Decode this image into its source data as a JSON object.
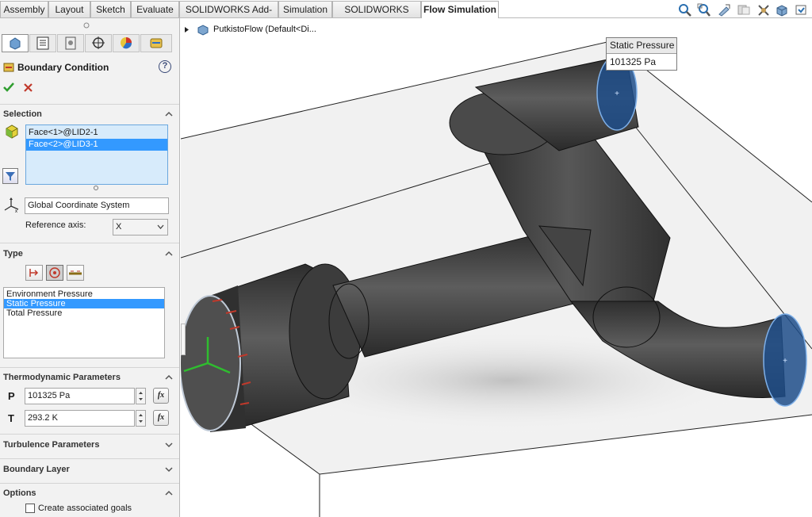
{
  "tabs": [
    {
      "label": "Assembly",
      "active": false
    },
    {
      "label": "Layout",
      "active": false
    },
    {
      "label": "Sketch",
      "active": false
    },
    {
      "label": "Evaluate",
      "active": false
    },
    {
      "label": "SOLIDWORKS Add-Ins",
      "active": false
    },
    {
      "label": "Simulation",
      "active": false
    },
    {
      "label": "SOLIDWORKS MBD",
      "active": false
    },
    {
      "label": "Flow Simulation",
      "active": true
    }
  ],
  "toolbar_icons": [
    "zoom-to-fit-icon",
    "zoom-area-icon",
    "previous-view-icon",
    "section-view-icon",
    "hide-show-icon",
    "display-style-icon",
    "view-orientation-icon"
  ],
  "tree": {
    "root_label": "PutkistoFlow  (Default<Di..."
  },
  "panel": {
    "title": "Boundary Condition",
    "help": "?",
    "selection": {
      "header": "Selection",
      "faces": [
        {
          "label": "Face<1>@LID2-1",
          "selected": false
        },
        {
          "label": "Face<2>@LID3-1",
          "selected": true
        }
      ],
      "coordinate_system": "Global Coordinate System",
      "reference_axis_label": "Reference axis:",
      "reference_axis_value": "X"
    },
    "type": {
      "header": "Type",
      "options": [
        {
          "label": "Environment Pressure",
          "selected": false
        },
        {
          "label": "Static Pressure",
          "selected": true
        },
        {
          "label": "Total Pressure",
          "selected": false
        }
      ]
    },
    "thermo": {
      "header": "Thermodynamic Parameters",
      "p_label": "P",
      "p_value": "101325 Pa",
      "t_label": "T",
      "t_value": "293.2 K",
      "fx": "fx"
    },
    "turbulence": {
      "header": "Turbulence Parameters"
    },
    "boundary_layer": {
      "header": "Boundary Layer"
    },
    "options": {
      "header": "Options",
      "create_goals": "Create associated goals",
      "create_goals_checked": false
    }
  },
  "tooltip": {
    "title": "Static Pressure",
    "value": "101325 Pa"
  },
  "colors": {
    "accent_blue": "#3399ff",
    "face_blue": "#1f4e8a",
    "pipe_dark": "#3a3a3a",
    "ok_green": "#2f9e2f",
    "cancel_red": "#c0392b"
  }
}
